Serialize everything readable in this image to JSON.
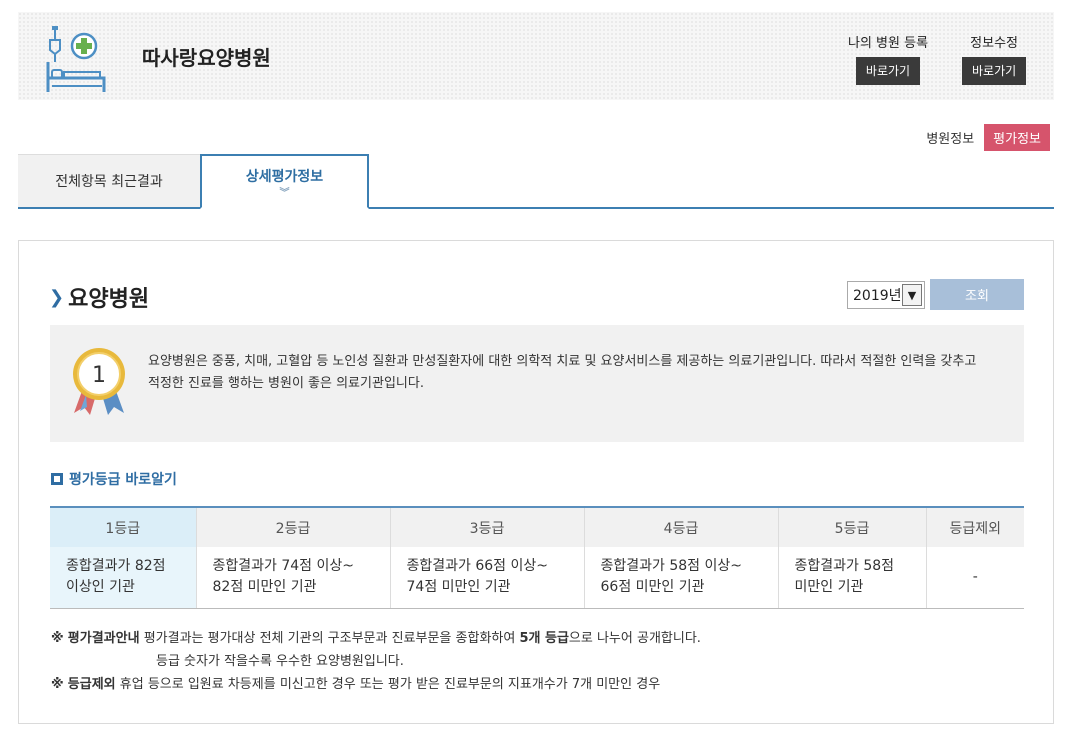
{
  "header": {
    "hospital_name": "따사랑요양병원",
    "register_label": "나의 병원 등록",
    "register_button": "바로가기",
    "edit_label": "정보수정",
    "edit_button": "바로가기"
  },
  "toplinks": {
    "hospital_info": "병원정보",
    "evaluation_info": "평가정보"
  },
  "tabs": [
    {
      "label": "전체항목 최근결과"
    },
    {
      "label": "상세평가정보",
      "chevron": "»"
    }
  ],
  "section": {
    "title": "요양병원",
    "year": "2019년",
    "search_button": "조회"
  },
  "info": {
    "medal_grade": "1",
    "text": "요양병원은 중풍, 치매, 고혈압 등 노인성 질환과 만성질환자에 대한 의학적 치료 및 요양서비스를 제공하는 의료기관입니다. 따라서 적절한 인력을 갖추고 적정한 진료를 행하는 병원이 좋은 의료기관입니다."
  },
  "grades": {
    "heading": "평가등급 바로알기",
    "headers": [
      "1등급",
      "2등급",
      "3등급",
      "4등급",
      "5등급",
      "등급제외"
    ],
    "row": [
      [
        "종합결과가 82점",
        "이상인 기관"
      ],
      [
        "종합결과가 74점 이상~",
        "82점 미만인 기관"
      ],
      [
        "종합결과가 66점 이상~",
        "74점 미만인 기관"
      ],
      [
        "종합결과가 58점 이상~",
        "66점 미만인 기관"
      ],
      [
        "종합결과가 58점",
        "미만인 기관"
      ],
      [
        "-",
        ""
      ]
    ]
  },
  "notes": {
    "n1_mark": "※",
    "n1_title": "평가결과안내",
    "n1_text_a": "평가결과는 평가대상 전체 기관의 구조부문과 진료부문을 종합화하여",
    "n1_bold": "5개 등급",
    "n1_text_b": "으로 나누어 공개합니다.",
    "n1_line2": "등급 숫자가 작을수록 우수한 요양병원입니다.",
    "n2_mark": "※",
    "n2_title": "등급제외",
    "n2_text": "휴업 등으로 입원료 차등제를 미신고한 경우 또는 평가 받은 진료부문의 지표개수가 7개 미만인 경우"
  }
}
